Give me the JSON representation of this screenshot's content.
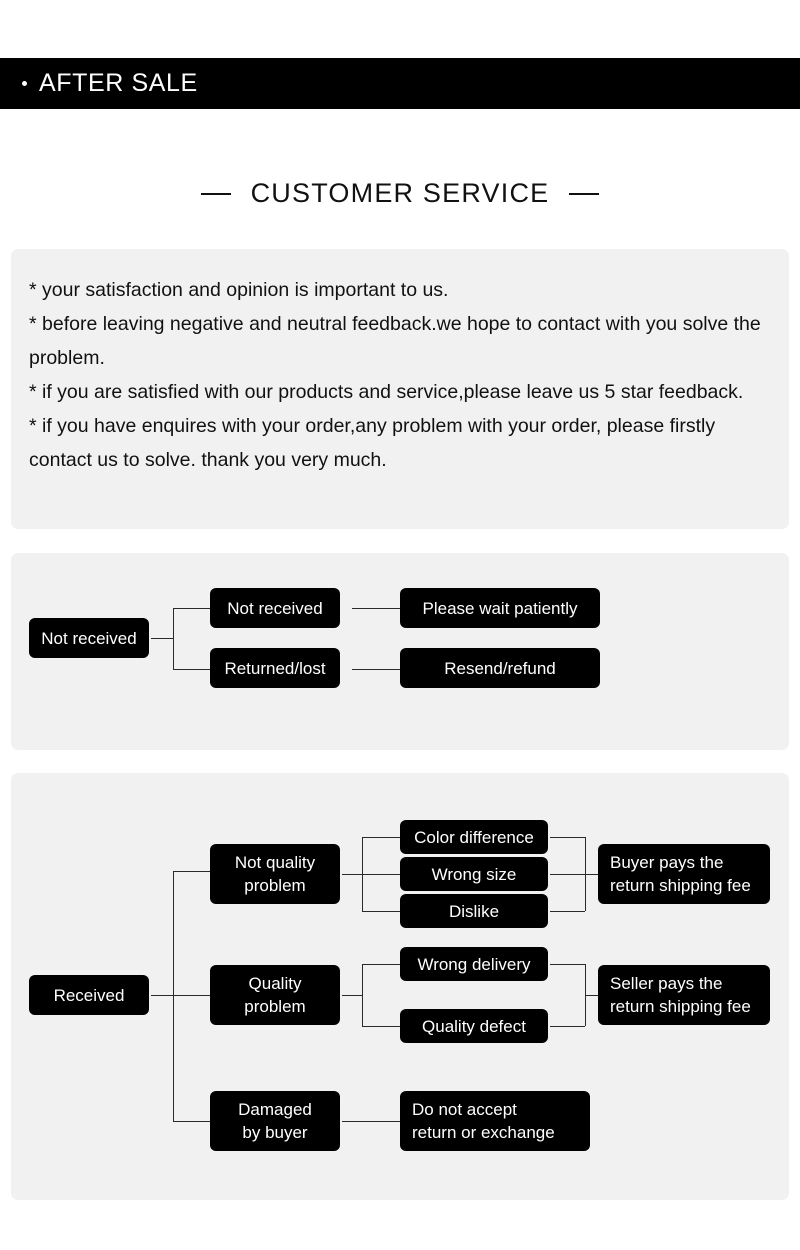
{
  "header": {
    "bullet_icon": "dot-icon",
    "title": "AFTER SALE"
  },
  "section": {
    "title": "CUSTOMER SERVICE",
    "left_dash": "dash-icon",
    "right_dash": "dash-icon"
  },
  "policy": {
    "lines": [
      "* your satisfaction and opinion is important to us.",
      "* before leaving negative and neutral feedback.we hope to contact with you solve the problem.",
      "* if you are satisfied with our products and service,please leave us 5 star feedback.",
      "* if you have enquires with your order,any problem with your order, please firstly contact us to solve. thank you very much."
    ]
  },
  "flow_not_received": {
    "root": "Not received",
    "branches": [
      {
        "cause": "Not received",
        "outcome": "Please wait patiently"
      },
      {
        "cause": "Returned/lost",
        "outcome": "Resend/refund"
      }
    ]
  },
  "flow_received": {
    "root": "Received",
    "groups": [
      {
        "category": "Not quality\nproblem",
        "reasons": [
          "Color difference",
          "Wrong size",
          "Dislike"
        ],
        "outcome": "Buyer pays the\nreturn shipping fee"
      },
      {
        "category": "Quality\nproblem",
        "reasons": [
          "Wrong delivery",
          "Quality defect"
        ],
        "outcome": "Seller pays the\nreturn shipping fee"
      },
      {
        "category": "Damaged\nby buyer",
        "reasons": [],
        "outcome": "Do not accept\nreturn or exchange"
      }
    ]
  },
  "colors": {
    "page_background": "#ffffff",
    "panel_background": "#f1f1f1",
    "node_background": "#000000",
    "node_text": "#ffffff",
    "header_background": "#000000",
    "header_text": "#ffffff",
    "body_text": "#111111",
    "connector": "#2a2a2a"
  }
}
